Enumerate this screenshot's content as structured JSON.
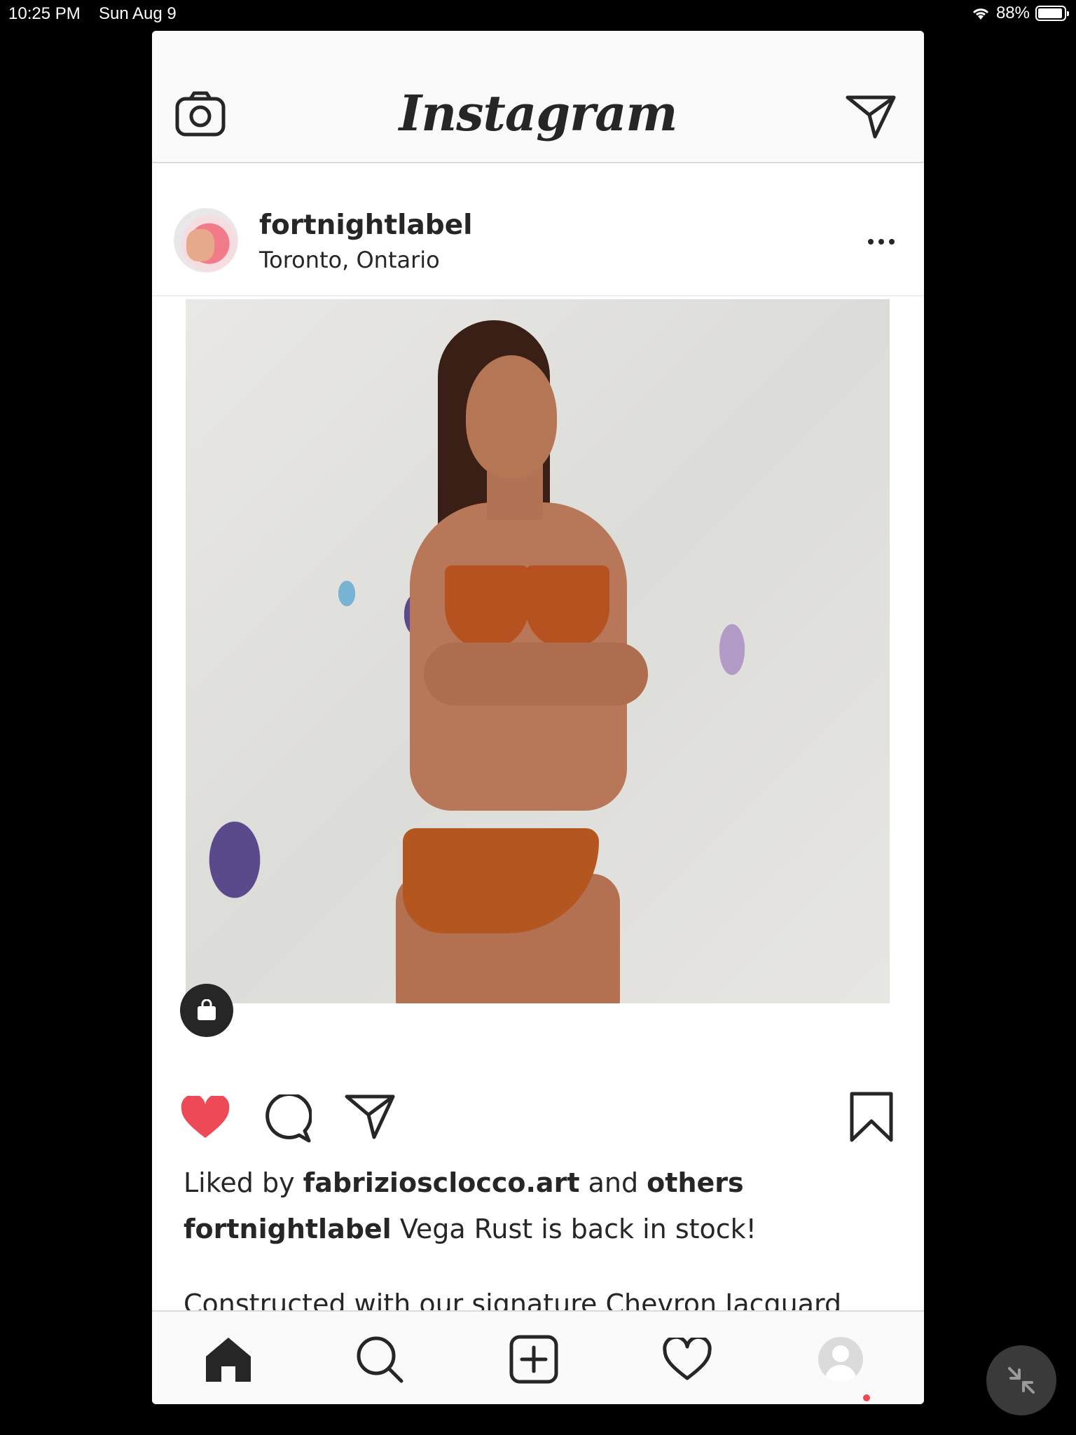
{
  "status_bar": {
    "time": "10:25 PM",
    "date": "Sun Aug 9",
    "battery": "88%"
  },
  "header": {
    "logo": "Instagram",
    "camera_icon": "camera-icon",
    "direct_icon": "paper-plane-icon"
  },
  "post": {
    "username": "fortnightlabel",
    "location": "Toronto, Ontario",
    "liked_by_prefix": "Liked by",
    "liked_by_user": "fabriziosclocco.art",
    "liked_by_and": "and",
    "liked_by_others": "others",
    "caption_user": "fortnightlabel",
    "caption_text": "Vega Rust is back in stock!",
    "description": "Constructed with our signature Chevron Jacquard Lace that’s strong and supportive, yet light as air."
  },
  "tab_bar": {
    "items": [
      "home-icon",
      "search-icon",
      "new-post-icon",
      "heart-icon",
      "profile-icon"
    ]
  },
  "colors": {
    "like_red": "#ed4956",
    "text": "#262626",
    "border": "#dbdbdb"
  }
}
